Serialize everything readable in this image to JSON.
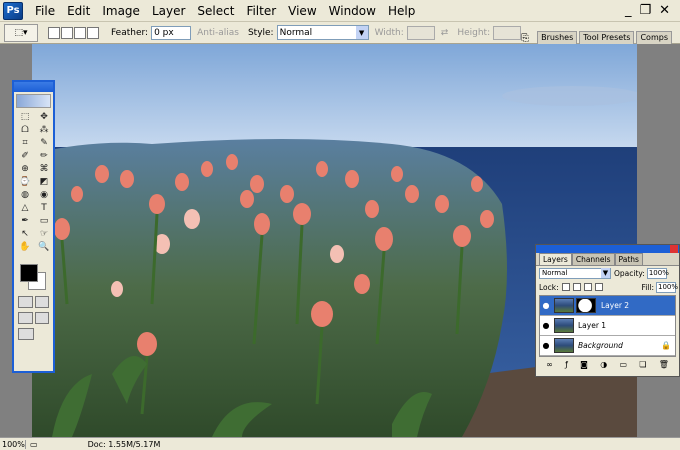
{
  "app": {
    "icon_label": "Ps"
  },
  "menu": [
    "File",
    "Edit",
    "Image",
    "Layer",
    "Select",
    "Filter",
    "View",
    "Window",
    "Help"
  ],
  "window_controls": {
    "minimize": "_",
    "restore": "❐",
    "close": "✕"
  },
  "options": {
    "feather_label": "Feather:",
    "feather_value": "0 px",
    "antialias_label": "Anti-alias",
    "style_label": "Style:",
    "style_value": "Normal",
    "width_label": "Width:",
    "height_label": "Height:"
  },
  "palette_well": [
    "Brushes",
    "Tool Presets",
    "Comps"
  ],
  "toolbox": {
    "tools": [
      "⬚",
      "✥",
      "ᗝ",
      "⁂",
      "⌗",
      "✎",
      "✐",
      "✏",
      "⊕",
      "⌘",
      "⌚",
      "◩",
      "◍",
      "◉",
      "△",
      "✋",
      "✒",
      "T",
      "↖",
      "▭",
      "☞",
      "🔍"
    ]
  },
  "layers": {
    "tabs": [
      "Layers",
      "Channels",
      "Paths"
    ],
    "blend_mode": "Normal",
    "opacity_label": "Opacity:",
    "opacity_value": "100%",
    "lock_label": "Lock:",
    "fill_label": "Fill:",
    "fill_value": "100%",
    "items": [
      {
        "name": "Layer 2"
      },
      {
        "name": "Layer 1"
      },
      {
        "name": "Background"
      }
    ],
    "footer_icons": [
      "link-icon",
      "fx-icon",
      "mask-icon",
      "adjust-icon",
      "folder-icon",
      "new-layer-icon",
      "trash-icon"
    ]
  },
  "status": {
    "zoom": "100%",
    "doc": "Doc: 1.55M/5.17M"
  },
  "colors": {
    "title_blue": "#1c5fd6",
    "chrome": "#ece9d8",
    "selected_layer": "#316ac5"
  }
}
